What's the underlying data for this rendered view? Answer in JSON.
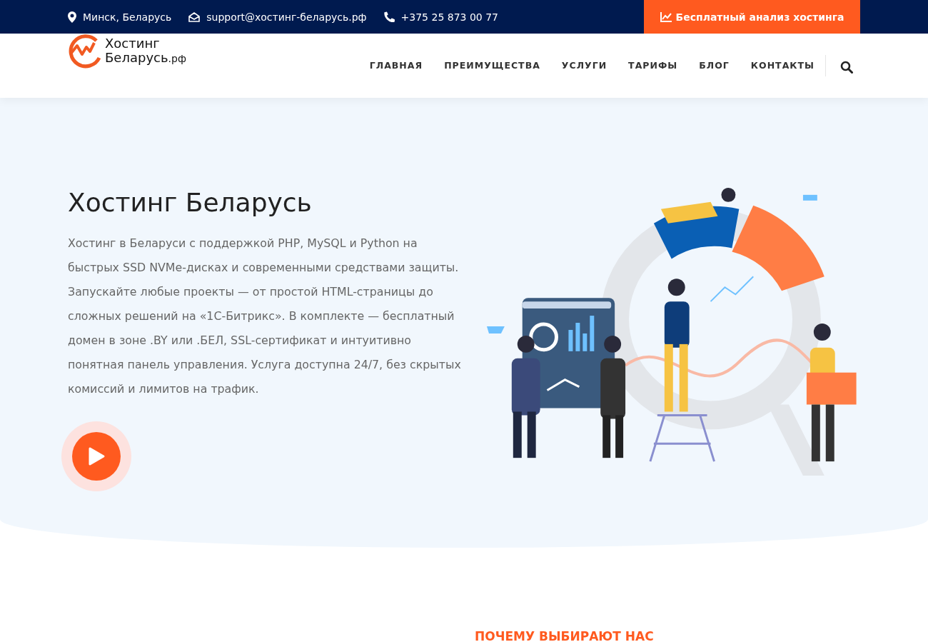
{
  "top_bar": {
    "location": "Минск, Беларусь",
    "email": "support@хостинг-беларусь.рф",
    "phone": "+375 25 873 00 77",
    "cta": "Бесплатный анализ хостинга"
  },
  "header": {
    "logo": {
      "line1": "Хостинг",
      "line2": "Беларусь",
      "suffix": ".рф"
    },
    "nav": [
      "ГЛАВНАЯ",
      "ПРЕИМУЩЕСТВА",
      "УСЛУГИ",
      "ТАРИФЫ",
      "БЛОГ",
      "КОНТАКТЫ"
    ]
  },
  "hero": {
    "title": "Хостинг Беларусь",
    "text": "Хостинг в Беларуси с поддержкой PHP, MySQL и Python на быстрых SSD NVMe-дисках и современными средствами защиты. Запускайте любые проекты — от простой HTML-страницы до сложных решений на «1С-Битрикс». В комплекте — бесплатный домен в зоне .BY или .БЕЛ, SSL-сертификат и интуитивно понятная панель управления. Услуга доступна 24/7, без скрытых комиссий и лимитов на трафик."
  },
  "next_section": {
    "heading": "ПОЧЕМУ ВЫБИРАЮТ НАС"
  }
}
